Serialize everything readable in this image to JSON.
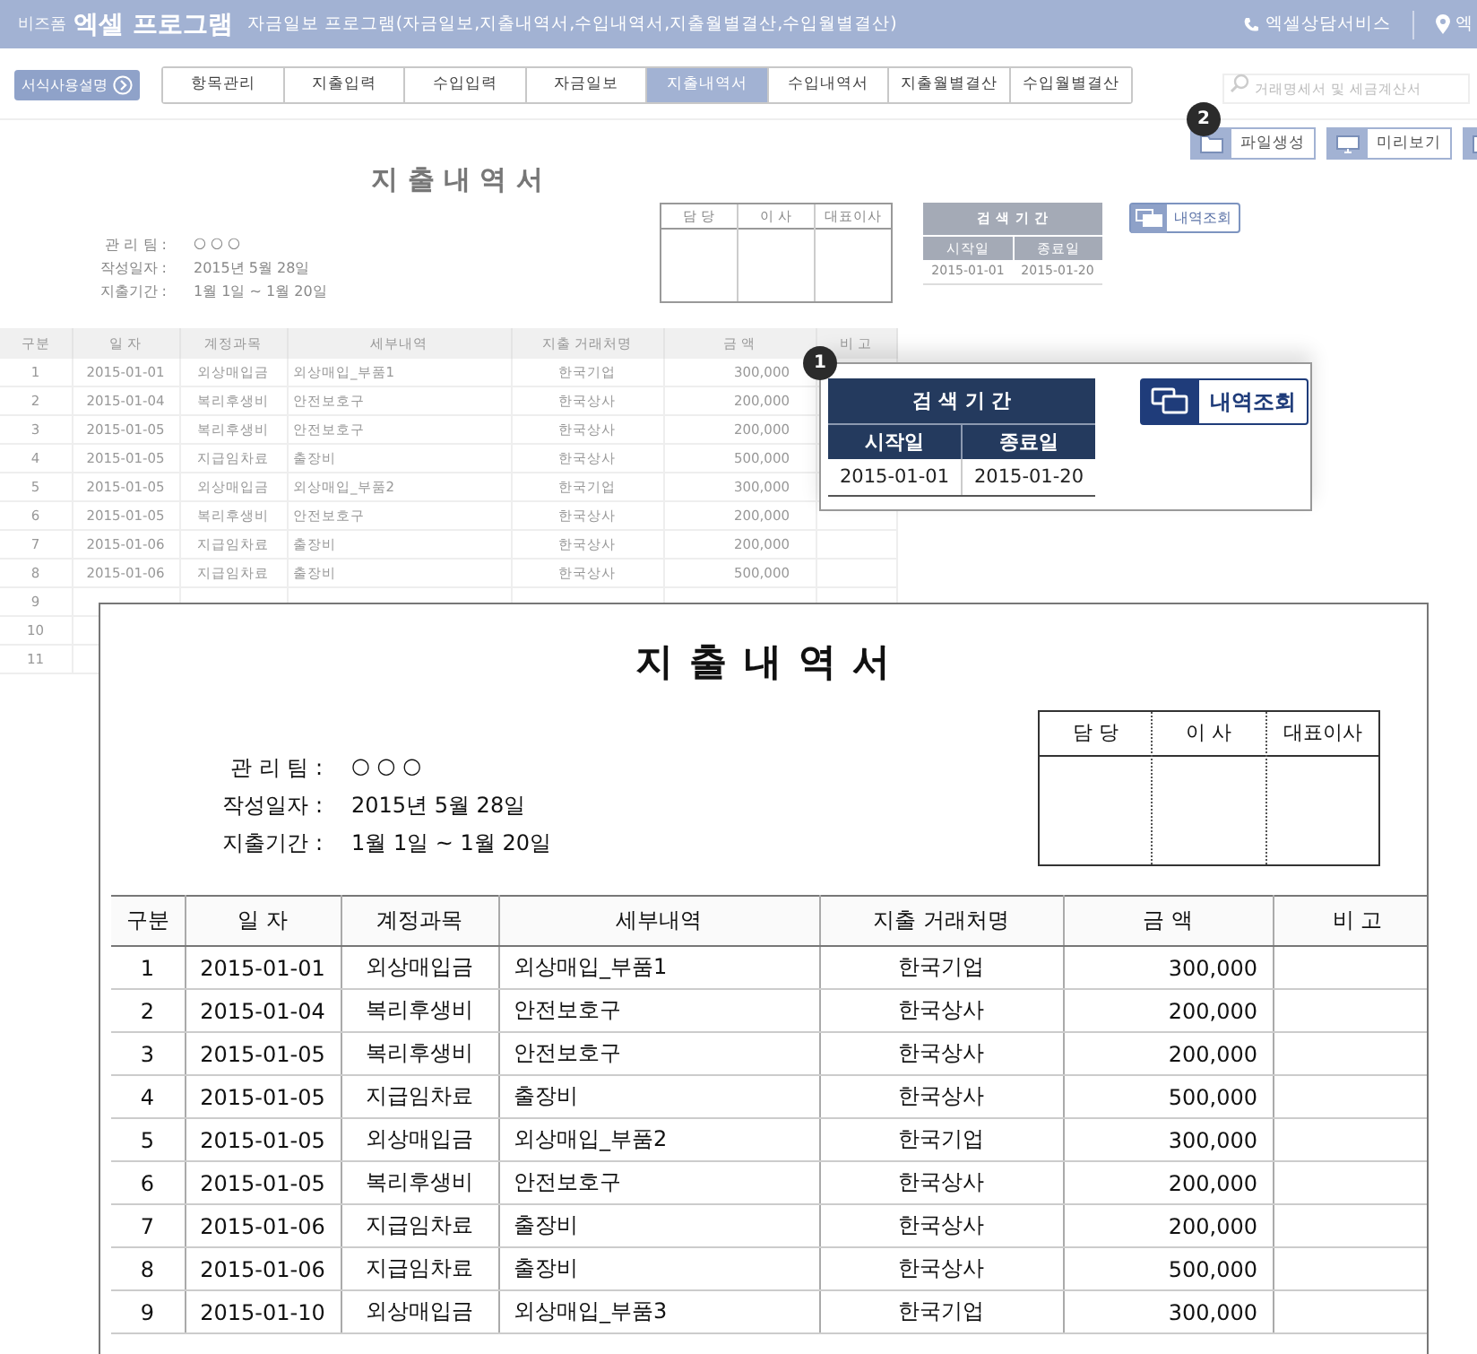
{
  "header": {
    "brand_small": "비즈폼",
    "brand": "엑셀 프로그램",
    "subtitle": "자금일보 프로그램(자금일보,지출내역서,수입내역서,지출월별결산,수입월별결산)",
    "links": [
      {
        "kind": "phone",
        "label": "엑셀상담서비스"
      },
      {
        "kind": "pin",
        "label": "엑"
      }
    ]
  },
  "guide_button": "서식사용설명",
  "tabs": [
    {
      "label": "항목관리",
      "selected": false
    },
    {
      "label": "지출입력",
      "selected": false
    },
    {
      "label": "수입입력",
      "selected": false
    },
    {
      "label": "자금일보",
      "selected": false
    },
    {
      "label": "지출내역서",
      "selected": true
    },
    {
      "label": "수입내역서",
      "selected": false
    },
    {
      "label": "지출월별결산",
      "selected": false
    },
    {
      "label": "수입월별결산",
      "selected": false
    }
  ],
  "search": {
    "placeholder": "거래명세서 및 세금계산서"
  },
  "toolbar": {
    "badge": "2",
    "buttons": [
      {
        "kind": "folder",
        "label": "파일생성"
      },
      {
        "kind": "monitor",
        "label": "미리보기"
      },
      {
        "kind": "folder"
      }
    ]
  },
  "sheet": {
    "title": "지 출 내 역 서",
    "info": [
      {
        "label": "관 리 팀 :",
        "value": "○ ○ ○"
      },
      {
        "label": "작성일자 :",
        "value": "2015년 5월 28일"
      },
      {
        "label": "지출기간 :",
        "value": "1월 1일 ~ 1월 20일"
      }
    ],
    "approval": [
      "담 당",
      "이 사",
      "대표이사"
    ],
    "period": {
      "title": "검 색 기 간",
      "start_label": "시작일",
      "end_label": "종료일",
      "start": "2015-01-01",
      "end": "2015-01-20"
    },
    "query_button": "내역조회",
    "table": {
      "columns": [
        "구분",
        "일 자",
        "계정과목",
        "세부내역",
        "지출 거래처명",
        "금  액",
        "비 고"
      ],
      "rows": [
        [
          "1",
          "2015-01-01",
          "외상매입금",
          "외상매입_부품1",
          "한국기업",
          "300,000"
        ],
        [
          "2",
          "2015-01-04",
          "복리후생비",
          "안전보호구",
          "한국상사",
          "200,000"
        ],
        [
          "3",
          "2015-01-05",
          "복리후생비",
          "안전보호구",
          "한국상사",
          "200,000"
        ],
        [
          "4",
          "2015-01-05",
          "지급임차료",
          "출장비",
          "한국상사",
          "500,000"
        ],
        [
          "5",
          "2015-01-05",
          "외상매입금",
          "외상매입_부품2",
          "한국기업",
          "300,000"
        ],
        [
          "6",
          "2015-01-05",
          "복리후생비",
          "안전보호구",
          "한국상사",
          "200,000"
        ],
        [
          "7",
          "2015-01-06",
          "지급임차료",
          "출장비",
          "한국상사",
          "200,000"
        ],
        [
          "8",
          "2015-01-06",
          "지급임차료",
          "출장비",
          "한국상사",
          "500,000"
        ],
        [
          "9"
        ],
        [
          "10"
        ],
        [
          "11"
        ]
      ]
    }
  },
  "callout": {
    "badge": "1",
    "period": {
      "title": "검 색 기 간",
      "start_label": "시작일",
      "end_label": "종료일",
      "start": "2015-01-01",
      "end": "2015-01-20"
    },
    "query_button": "내역조회"
  },
  "preview": {
    "title": "지 출 내 역 서",
    "info": [
      {
        "label": "관 리 팀 :",
        "value": "○ ○ ○"
      },
      {
        "label": "작성일자 :",
        "value": "2015년 5월 28일"
      },
      {
        "label": "지출기간 :",
        "value": "1월 1일 ~ 1월 20일"
      }
    ],
    "approval": [
      "담 당",
      "이 사",
      "대표이사"
    ],
    "table": {
      "columns": [
        "구분",
        "일 자",
        "계정과목",
        "세부내역",
        "지출 거래처명",
        "금    액",
        "비 고"
      ],
      "rows": [
        [
          "1",
          "2015-01-01",
          "외상매입금",
          "외상매입_부품1",
          "한국기업",
          "300,000"
        ],
        [
          "2",
          "2015-01-04",
          "복리후생비",
          "안전보호구",
          "한국상사",
          "200,000"
        ],
        [
          "3",
          "2015-01-05",
          "복리후생비",
          "안전보호구",
          "한국상사",
          "200,000"
        ],
        [
          "4",
          "2015-01-05",
          "지급임차료",
          "출장비",
          "한국상사",
          "500,000"
        ],
        [
          "5",
          "2015-01-05",
          "외상매입금",
          "외상매입_부품2",
          "한국기업",
          "300,000"
        ],
        [
          "6",
          "2015-01-05",
          "복리후생비",
          "안전보호구",
          "한국상사",
          "200,000"
        ],
        [
          "7",
          "2015-01-06",
          "지급임차료",
          "출장비",
          "한국상사",
          "200,000"
        ],
        [
          "8",
          "2015-01-06",
          "지급임차료",
          "출장비",
          "한국상사",
          "500,000"
        ],
        [
          "9",
          "2015-01-10",
          "외상매입금",
          "외상매입_부품3",
          "한국기업",
          "300,000"
        ]
      ]
    }
  }
}
